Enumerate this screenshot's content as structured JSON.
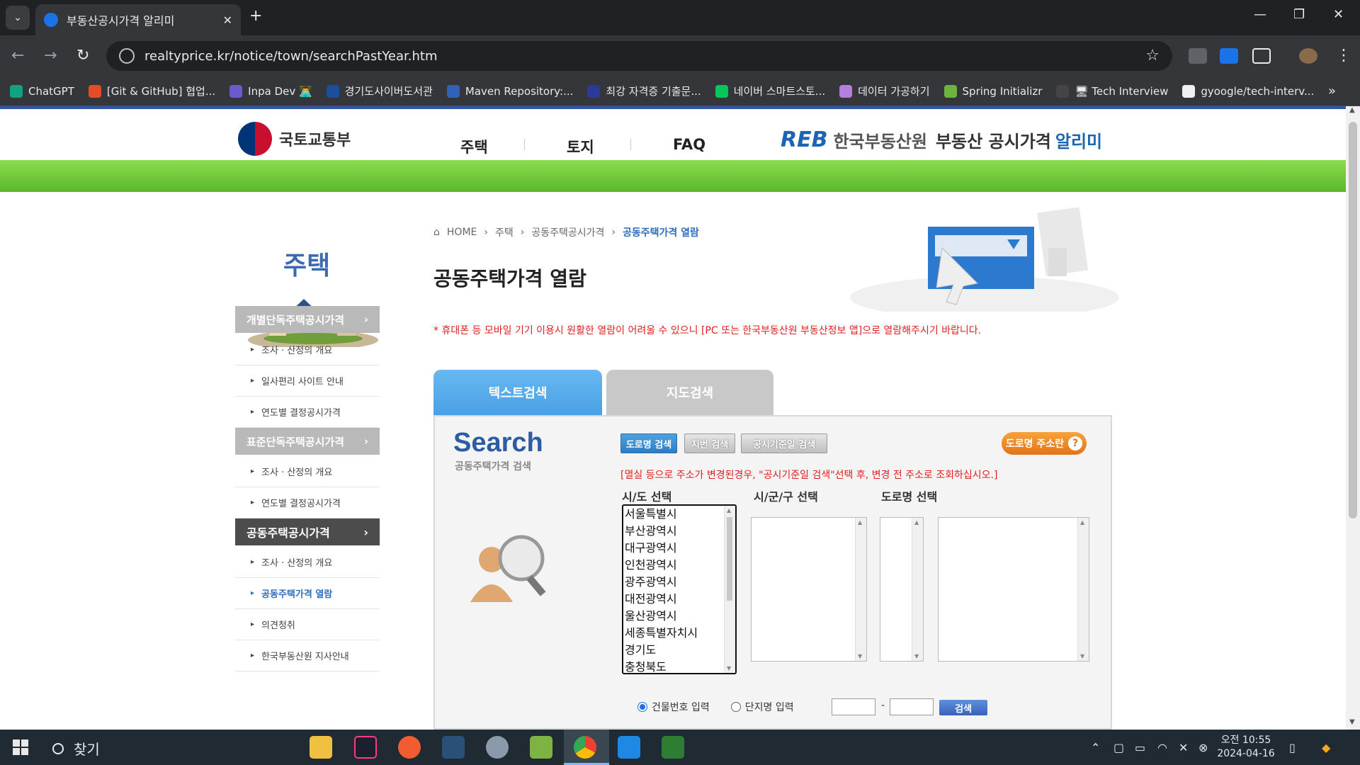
{
  "browser": {
    "tab_title": "부동산공시가격 알리미",
    "url": "realtyprice.kr/notice/town/searchPastYear.htm",
    "bookmarks": [
      {
        "label": "ChatGPT",
        "color": "#10a37f"
      },
      {
        "label": "[Git & GitHub] 협업...",
        "color": "#e34c26"
      },
      {
        "label": "Inpa Dev 👨‍💻",
        "color": "#6a5acd"
      },
      {
        "label": "경기도사이버도서관",
        "color": "#1b4f9c"
      },
      {
        "label": "Maven Repository:...",
        "color": "#2f62b8"
      },
      {
        "label": "최강 자격증 기출문...",
        "color": "#2b3a9a"
      },
      {
        "label": "네이버 스마트스토...",
        "color": "#03c75a"
      },
      {
        "label": "데이터 가공하기",
        "color": "#b57edc"
      },
      {
        "label": "Spring Initializr",
        "color": "#6db33f"
      },
      {
        "label": "🖥 Tech Interview",
        "color": "#444444"
      },
      {
        "label": "gyoogle/tech-interv...",
        "color": "#f0f0f0"
      }
    ]
  },
  "header": {
    "ministry": "국토교통부",
    "nav": [
      "주택",
      "토지",
      "FAQ"
    ],
    "reb_mark": "REB",
    "reb_org": "한국부동산원",
    "reb_service": "부동산 공시가격",
    "reb_service2": "알리미"
  },
  "sidebar": {
    "title": "주택",
    "sections": [
      {
        "label": "개별단독주택공시가격",
        "items": [
          "조사 · 산정의 개요",
          "일사편리 사이트 안내",
          "연도별 결정공시가격"
        ]
      },
      {
        "label": "표준단독주택공시가격",
        "items": [
          "조사 · 산정의 개요",
          "연도별 결정공시가격"
        ]
      },
      {
        "label": "공동주택공시가격",
        "items": [
          "조사 · 산정의 개요",
          "공동주택가격 열람",
          "의견청취",
          "한국부동산원 지사안내"
        ]
      }
    ]
  },
  "main": {
    "breadcrumb": [
      "HOME",
      "주택",
      "공동주택공시가격",
      "공동주택가격 열람"
    ],
    "title": "공동주택가격 열람",
    "notice": "* 휴대폰 등 모바일 기기 이용시 원활한 열람이 어려울 수 있으니 [PC 또는 한국부동산원 부동산정보 앱]으로 열람해주시기 바랍니다.",
    "tabs": [
      "텍스트검색",
      "지도검색"
    ],
    "search_logo": "Search",
    "search_sub": "공동주택가격 검색",
    "buttons": [
      "도로명 검색",
      "지번 검색",
      "공시기준일 검색"
    ],
    "guide_button": "도로명 주소란",
    "guide_q": "?",
    "warning": "[멸실 등으로 주소가 변경된경우, \"공시기준일 검색\"선택 후, 변경 전 주소로 조회하십시오.]",
    "labels": {
      "sido": "시/도 선택",
      "sigungu": "시/군/구 선택",
      "road": "도로명 선택"
    },
    "sido_options": [
      "서울특별시",
      "부산광역시",
      "대구광역시",
      "인천광역시",
      "광주광역시",
      "대전광역시",
      "울산광역시",
      "세종특별자치시",
      "경기도",
      "충청북도"
    ],
    "radio_building": "건물번호 입력",
    "radio_complex": "단지명 입력",
    "dash": "-",
    "search_button": "검색"
  },
  "taskbar": {
    "search_label": "찾기",
    "time": "오전 10:55",
    "date": "2024-04-16"
  }
}
